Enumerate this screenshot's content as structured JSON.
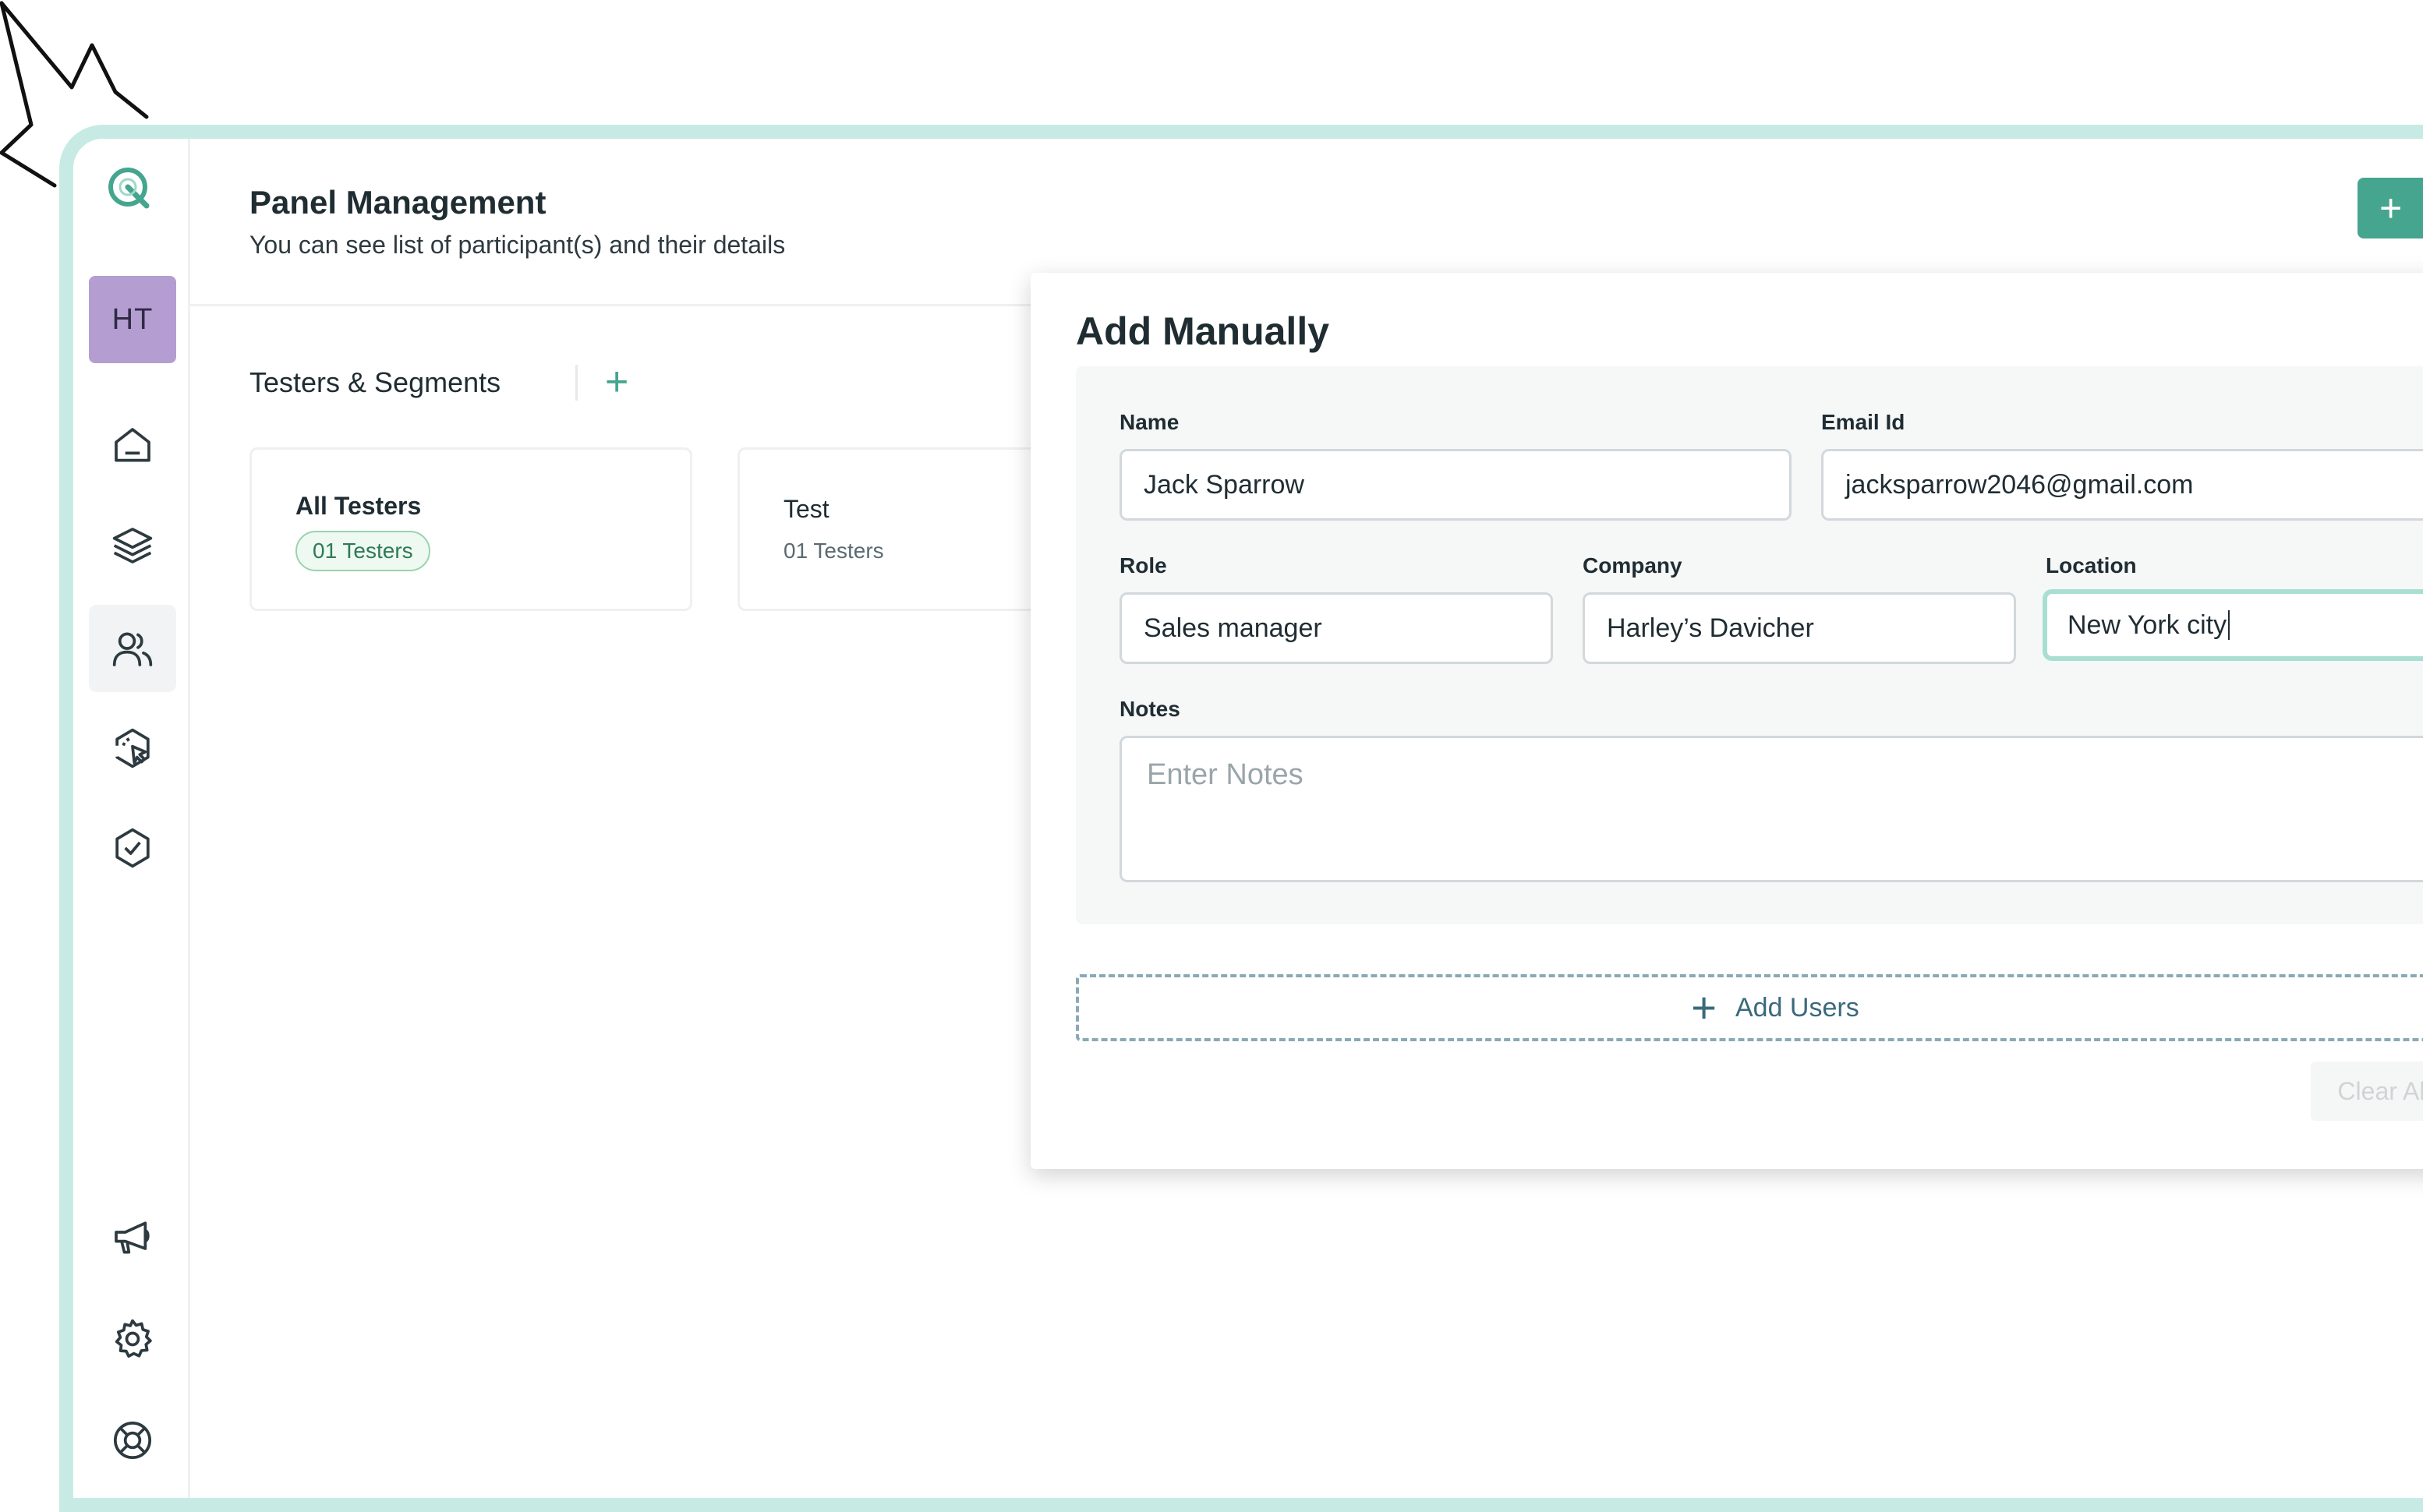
{
  "page": {
    "title": "Panel Management",
    "subtitle": "You can see list of participant(s) and their details",
    "add_button_label": "+"
  },
  "sidebar": {
    "avatar_initials": "HT",
    "items": [
      {
        "icon": "home-icon"
      },
      {
        "icon": "layers-icon"
      },
      {
        "icon": "users-icon",
        "active": true
      },
      {
        "icon": "cursor-click-icon"
      },
      {
        "icon": "verified-badge-icon"
      },
      {
        "icon": "megaphone-icon"
      },
      {
        "icon": "gear-icon"
      },
      {
        "icon": "lifebuoy-icon"
      }
    ]
  },
  "segments": {
    "title": "Testers & Segments",
    "add_label": "+",
    "cards": [
      {
        "name": "All Testers",
        "count": "01 Testers"
      },
      {
        "name": "Test",
        "count": "01 Testers"
      }
    ]
  },
  "modal": {
    "title": "Add Manually",
    "fields": {
      "name": {
        "label": "Name",
        "value": "Jack Sparrow"
      },
      "email": {
        "label": "Email Id",
        "value": "jacksparrow2046@gmail.com"
      },
      "role": {
        "label": "Role",
        "value": "Sales manager"
      },
      "company": {
        "label": "Company",
        "value": "Harley’s Davicher"
      },
      "location": {
        "label": "Location",
        "value": "New York city"
      },
      "notes": {
        "label": "Notes",
        "placeholder": "Enter Notes"
      }
    },
    "add_users_label": "Add Users",
    "clear_all_label": "Clear All"
  },
  "colors": {
    "accent": "#46a58e",
    "frame": "#c7ebe4",
    "avatar": "#b49ed1"
  }
}
